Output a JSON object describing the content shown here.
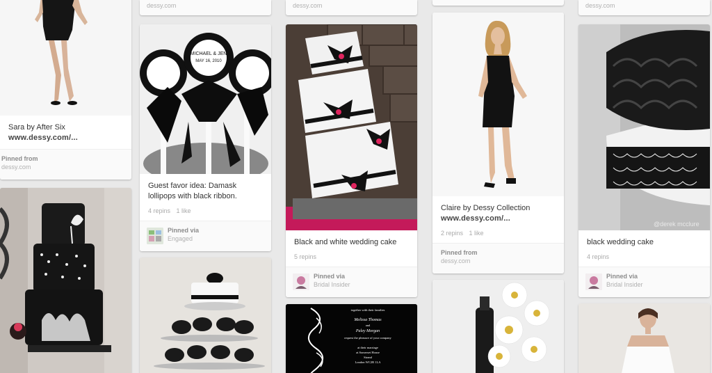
{
  "pins": {
    "p1": {
      "desc": "Sara by After Six",
      "link": "www.dessy.com/...",
      "pinned_from": "Pinned from",
      "source": "dessy.com"
    },
    "p2": {
      "desc": "Guest favor idea: Damask lollipops with black ribbon.",
      "repins": "4 repins",
      "likes": "1 like",
      "pinned_via": "Pinned via",
      "board": "Engaged",
      "lolly_text": "MICHAEL & JEN",
      "lolly_date": "MAY 16, 2010"
    },
    "p3": {
      "desc": "Black and white wedding cake",
      "repins": "5 repins",
      "pinned_via": "Pinned via",
      "board": "Bridal Insider"
    },
    "p4": {
      "desc": "Claire by Dessy Collection",
      "link": "www.dessy.com/...",
      "repins": "2 repins",
      "likes": "1 like",
      "pinned_from": "Pinned from",
      "source": "dessy.com"
    },
    "p5": {
      "desc": "black wedding cake",
      "repins": "4 repins",
      "pinned_via": "Pinned via",
      "board": "Bridal Insider",
      "watermark": "@derek mcclure"
    },
    "top_sources": [
      "dessy.com",
      "dessy.com",
      "dessy.com"
    ],
    "invite_lines": [
      "together with their families",
      "Melissa Thomas",
      "and",
      "Paley Morgan",
      "request the pleasure of your company",
      "at their marriage",
      "at Somerset House",
      "Strand",
      "London WC2R 1LA"
    ]
  },
  "colors": {
    "background": "#e9e9e9",
    "card": "#ffffff",
    "muted": "#aaaaaa",
    "accent_pink": "#c2185b"
  }
}
